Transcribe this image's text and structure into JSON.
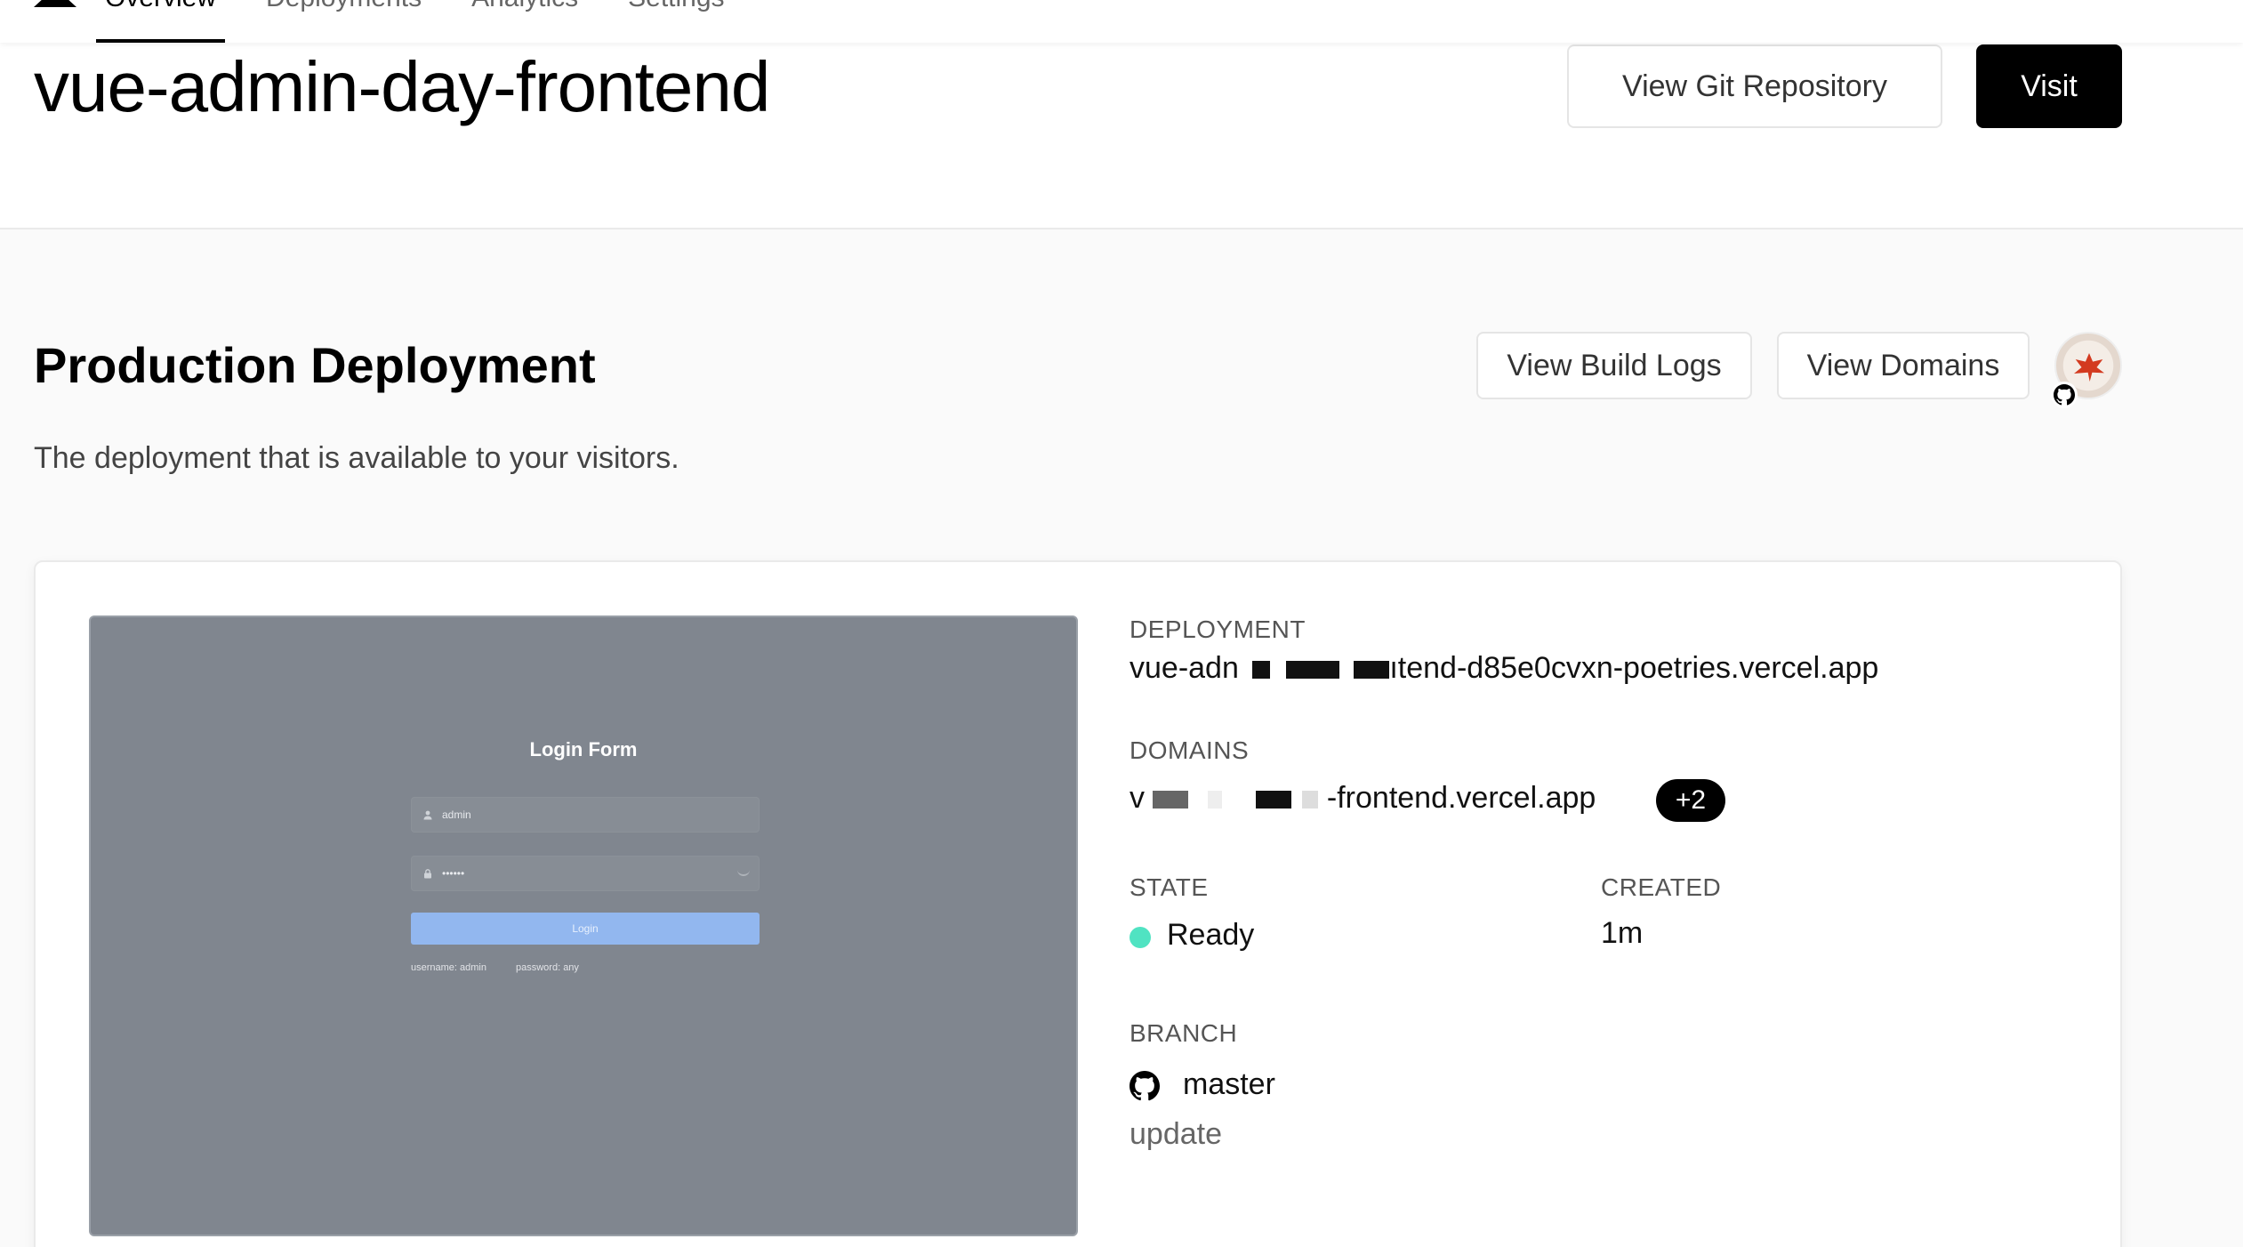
{
  "nav": {
    "tabs": [
      {
        "label": "Overview",
        "active": true
      },
      {
        "label": "Deployments"
      },
      {
        "label": "Analytics"
      },
      {
        "label": "Settings"
      }
    ]
  },
  "header": {
    "project_name": "vue-admin-day-frontend",
    "git_button": "View Git Repository",
    "visit_button": "Visit"
  },
  "production": {
    "title": "Production Deployment",
    "subtitle": "The deployment that is available to your visitors.",
    "logs_button": "View Build Logs",
    "domains_button": "View Domains",
    "avatar_icon": "maple-leaf-avatar",
    "source_icon": "github-icon"
  },
  "preview": {
    "title": "Login Form",
    "username_value": "admin",
    "password_value": "••••••",
    "login_button": "Login",
    "hint_username": "username: admin",
    "hint_password": "password: any"
  },
  "details": {
    "deployment_label": "DEPLOYMENT",
    "deployment_prefix": "vue-adn",
    "deployment_suffix": "ıtend-d85e0cvxn-poetries.vercel.app",
    "domains_label": "DOMAINS",
    "domains_prefix": "v",
    "domains_suffix": "-frontend.vercel.app",
    "domains_extra": "+2",
    "state_label": "STATE",
    "state_value": "Ready",
    "state_color": "#50e3c2",
    "created_label": "CREATED",
    "created_value": "1m",
    "branch_label": "BRANCH",
    "branch_value": "master",
    "commit_message": "update"
  }
}
